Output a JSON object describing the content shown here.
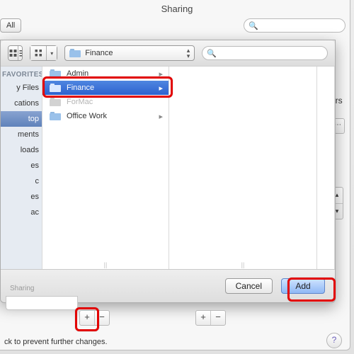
{
  "window": {
    "title": "Sharing",
    "showall": "All"
  },
  "topsearch": {
    "placeholder": ""
  },
  "sheet": {
    "path_label": "Finance",
    "search_placeholder": "",
    "sidebar": {
      "section": "FAVORITES",
      "items": [
        {
          "label": "y Files",
          "selected": false
        },
        {
          "label": "cations",
          "selected": false
        },
        {
          "label": "top",
          "selected": true
        },
        {
          "label": "ments",
          "selected": false
        },
        {
          "label": "loads",
          "selected": false
        },
        {
          "label": "es",
          "selected": false
        },
        {
          "label": "c",
          "selected": false
        },
        {
          "label": "es",
          "selected": false
        },
        {
          "label": "ac",
          "selected": false
        }
      ]
    },
    "col1": [
      {
        "label": "Admin",
        "hasChildren": true,
        "selected": false,
        "disabled": false
      },
      {
        "label": "Finance",
        "hasChildren": true,
        "selected": true,
        "disabled": false
      },
      {
        "label": "ForMac",
        "hasChildren": false,
        "selected": false,
        "disabled": true
      },
      {
        "label": "Office Work",
        "hasChildren": true,
        "selected": false,
        "disabled": false
      }
    ],
    "buttons": {
      "cancel": "Cancel",
      "add": "Add"
    }
  },
  "below": {
    "shared_label": "Sharing",
    "right_hint": "ors",
    "plus": "+",
    "minus": "−",
    "lock_text": "ck to prevent further changes.",
    "help": "?"
  }
}
